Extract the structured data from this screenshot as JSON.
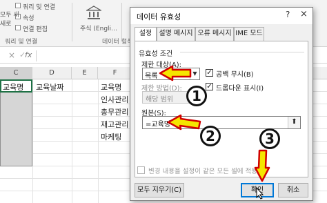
{
  "ribbon": {
    "items": [
      "쿼리 및 연결",
      "속성",
      "연결 편집",
      "새로",
      "최근에 사용한 원본",
      "기존 연결",
      "모두 새",
      "고침",
      "주식 (Engli…"
    ],
    "group_labels": [
      "쿼리 및 연결",
      "데이터 형식"
    ]
  },
  "formula_bar": {
    "cancel_icon": "×",
    "confirm_icon": "✓",
    "fx_label": "fx"
  },
  "sheet": {
    "columns": [
      "C",
      "D",
      "E",
      "F"
    ],
    "cells": {
      "c1": "교육명",
      "d1": "교육날짜",
      "f1": "교육명",
      "f2": "인사관리",
      "f3": "총무관리",
      "f4": "재고관리",
      "f5": "마케팅"
    }
  },
  "dialog": {
    "title": "데이터 유효성",
    "help_icon": "?",
    "close_icon": "×",
    "tabs": [
      "설정",
      "설명 메시지",
      "오류 메시지",
      "IME 모드"
    ],
    "validation_criteria_label": "유효성 조건",
    "allow_label": "제한 대상(A):",
    "allow_value": "목록",
    "ignore_blank_label": "공백 무시(B)",
    "in_cell_dropdown_label": "드롭다운 표시(I)",
    "data_label": "제한 방법(D):",
    "data_value": "해당 범위",
    "source_label": "원본(S):",
    "source_value": "=교육명",
    "apply_all_label": "변경 내용을 설정이 같은 모든 셀에 적용(P)",
    "clear_all_button": "모두 지우기(C)",
    "ok_button": "확인",
    "cancel_button": "취소"
  },
  "annotations": {
    "step1": "1",
    "step2": "2",
    "step3": "3"
  },
  "colors": {
    "accent": "#0078d7",
    "arrow": "#f5e600",
    "excel_green": "#1e7145"
  }
}
